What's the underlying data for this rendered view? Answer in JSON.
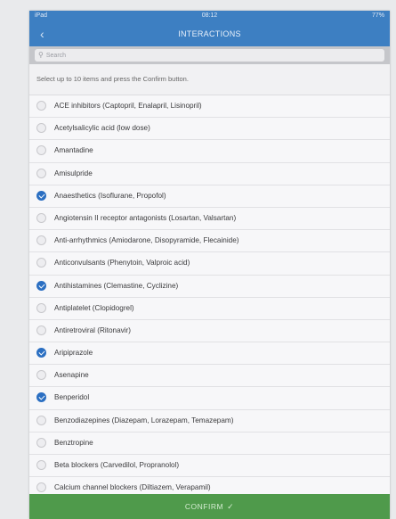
{
  "status_bar": {
    "carrier": "iPad",
    "time": "08:12",
    "battery": "77%"
  },
  "nav": {
    "title": "INTERACTIONS",
    "back_icon": "chevron-left-icon"
  },
  "search": {
    "placeholder": "Search"
  },
  "instruction": "Select up to 10 items and press the Confirm button.",
  "items": [
    {
      "label": "ACE inhibitors (Captopril, Enalapril, Lisinopril)",
      "checked": false
    },
    {
      "label": "Acetylsalicylic acid (low dose)",
      "checked": false
    },
    {
      "label": "Amantadine",
      "checked": false
    },
    {
      "label": "Amisulpride",
      "checked": false
    },
    {
      "label": "Anaesthetics (Isoflurane, Propofol)",
      "checked": true
    },
    {
      "label": "Angiotensin II receptor antagonists (Losartan, Valsartan)",
      "checked": false
    },
    {
      "label": "Anti-arrhythmics (Amiodarone, Disopyramide, Flecainide)",
      "checked": false
    },
    {
      "label": "Anticonvulsants (Phenytoin, Valproic acid)",
      "checked": false
    },
    {
      "label": "Antihistamines (Clemastine, Cyclizine)",
      "checked": true
    },
    {
      "label": "Antiplatelet (Clopidogrel)",
      "checked": false
    },
    {
      "label": "Antiretroviral (Ritonavir)",
      "checked": false
    },
    {
      "label": "Aripiprazole",
      "checked": true
    },
    {
      "label": "Asenapine",
      "checked": false
    },
    {
      "label": "Benperidol",
      "checked": true
    },
    {
      "label": "Benzodiazepines (Diazepam, Lorazepam, Temazepam)",
      "checked": false
    },
    {
      "label": "Benztropine",
      "checked": false
    },
    {
      "label": "Beta blockers (Carvedilol, Propranolol)",
      "checked": false
    },
    {
      "label": "Calcium channel blockers (Diltiazem, Verapamil)",
      "checked": false
    }
  ],
  "confirm": {
    "label": "CONFIRM",
    "icon": "checkmark-icon"
  },
  "colors": {
    "nav": "#3d7fc2",
    "check": "#2b6fc2",
    "confirm": "#4f9a4b"
  }
}
